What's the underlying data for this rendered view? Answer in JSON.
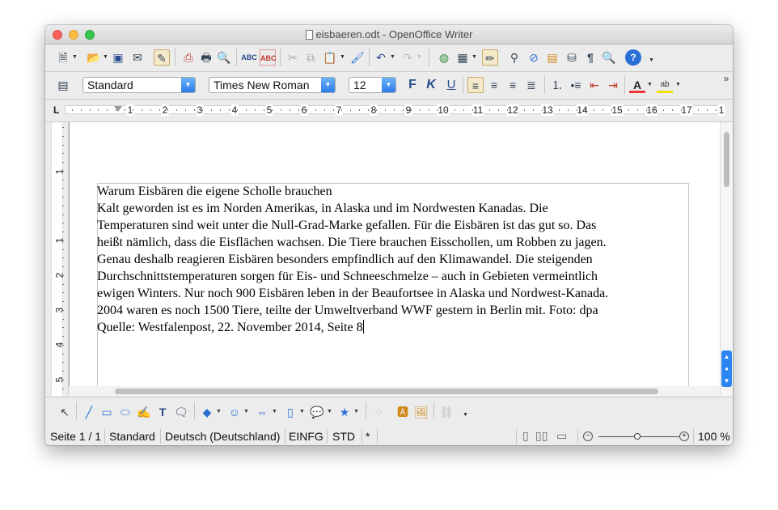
{
  "window": {
    "title": "eisbaeren.odt - OpenOffice Writer"
  },
  "toolbar": {
    "style_value": "Standard",
    "font_value": "Times New Roman",
    "size_value": "12",
    "bold_label": "F",
    "italic_label": "K",
    "underline_label": "U",
    "overflow_label": "»"
  },
  "ruler": {
    "tab_label": "L",
    "numbers": [
      "1",
      "2",
      "3",
      "4",
      "5",
      "6",
      "7",
      "8",
      "9",
      "10",
      "11",
      "12",
      "13",
      "14",
      "15",
      "16",
      "17",
      "1"
    ]
  },
  "vruler": {
    "numbers": [
      "1",
      "1",
      "2",
      "3",
      "4",
      "5"
    ]
  },
  "document": {
    "text": "Warum Eisbären die eigene Scholle brauchen\nKalt geworden ist es im Norden Amerikas, in Alaska und im Nordwesten Kanadas. Die\nTemperaturen sind weit unter die Null-Grad-Marke gefallen. Für die Eisbären ist das gut so. Das\nheißt nämlich, dass die Eisflächen wachsen. Die Tiere brauchen Eisschollen, um Robben zu jagen.\nGenau deshalb reagieren Eisbären besonders empfindlich auf den Klimawandel. Die steigenden\nDurchschnittstemperaturen sorgen für Eis- und Schneeschmelze – auch in Gebieten vermeintlich\newigen Winters. Nur noch 900 Eisbären leben in der Beaufortsee in Alaska und Nordwest-Kanada.\n2004 waren es noch 1500 Tiere, teilte der Umweltverband WWF gestern in Berlin mit. Foto: dpa\nQuelle: Westfalenpost, 22. November 2014, Seite 8"
  },
  "statusbar": {
    "page": "Seite 1 / 1",
    "style": "Standard",
    "language": "Deutsch (Deutschland)",
    "insert_mode": "EINFG",
    "selection_mode": "STD",
    "modified": "*",
    "zoom": "100 %"
  },
  "icons": {
    "toolbar1": [
      "new-document-icon",
      "open-icon",
      "save-icon",
      "email-icon",
      "edit-file-icon",
      "pdf-export-icon",
      "print-icon",
      "page-preview-icon",
      "spellcheck-icon",
      "auto-spellcheck-icon",
      "cut-icon",
      "copy-icon",
      "paste-icon",
      "format-paintbrush-icon",
      "undo-icon",
      "redo-icon",
      "hyperlink-icon",
      "table-icon",
      "show-draw-icon",
      "find-replace-icon",
      "navigator-icon",
      "gallery-icon",
      "data-sources-icon",
      "formatting-marks-icon",
      "zoom-icon",
      "help-icon"
    ],
    "drawbar": [
      "select-arrow-icon",
      "line-icon",
      "rectangle-icon",
      "ellipse-icon",
      "freeform-icon",
      "text-icon",
      "callout-icon",
      "basic-shapes-icon",
      "symbol-shapes-icon",
      "block-arrows-icon",
      "flowchart-icon",
      "callouts-icon",
      "stars-icon",
      "points-icon",
      "fontwork-icon",
      "from-file-icon",
      "extrusion-icon"
    ]
  },
  "colors": {
    "accent": "#2b7de9",
    "close": "#fc605c",
    "minimize": "#fdbc40",
    "maximize": "#34c84a"
  }
}
